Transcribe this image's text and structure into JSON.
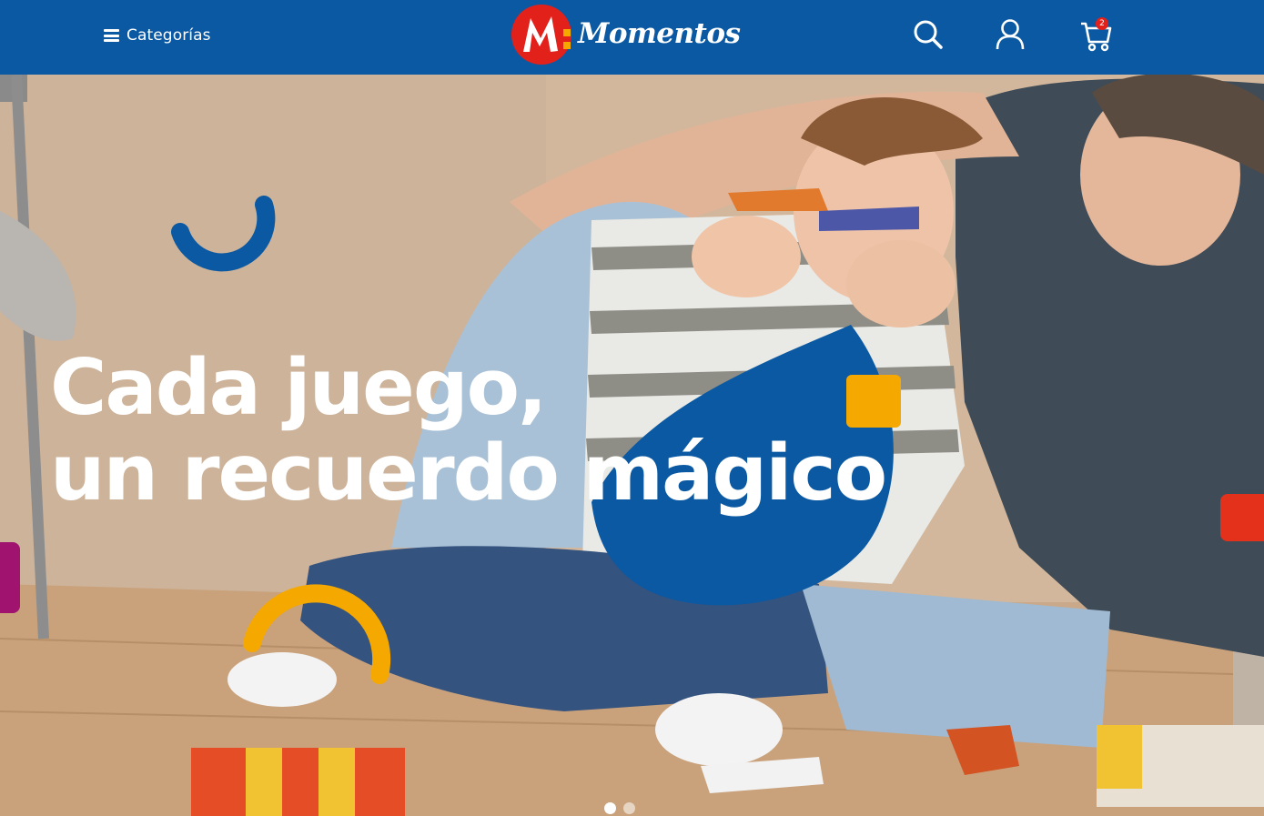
{
  "header": {
    "menu_label": "Categorías",
    "logo_text": "Momentos",
    "cart_count": "2",
    "icons": [
      "menu-icon",
      "search-icon",
      "user-icon",
      "cart-icon"
    ]
  },
  "hero": {
    "headline_line1": "Cada juego,",
    "headline_line2": "un recuerdo mágico",
    "carousel": {
      "slides": 2,
      "active_slide": 1
    }
  },
  "colors": {
    "brand_blue": "#0a59a2",
    "accent_yellow": "#f5a800",
    "accent_red": "#e3311b",
    "accent_magenta": "#a0136f"
  }
}
